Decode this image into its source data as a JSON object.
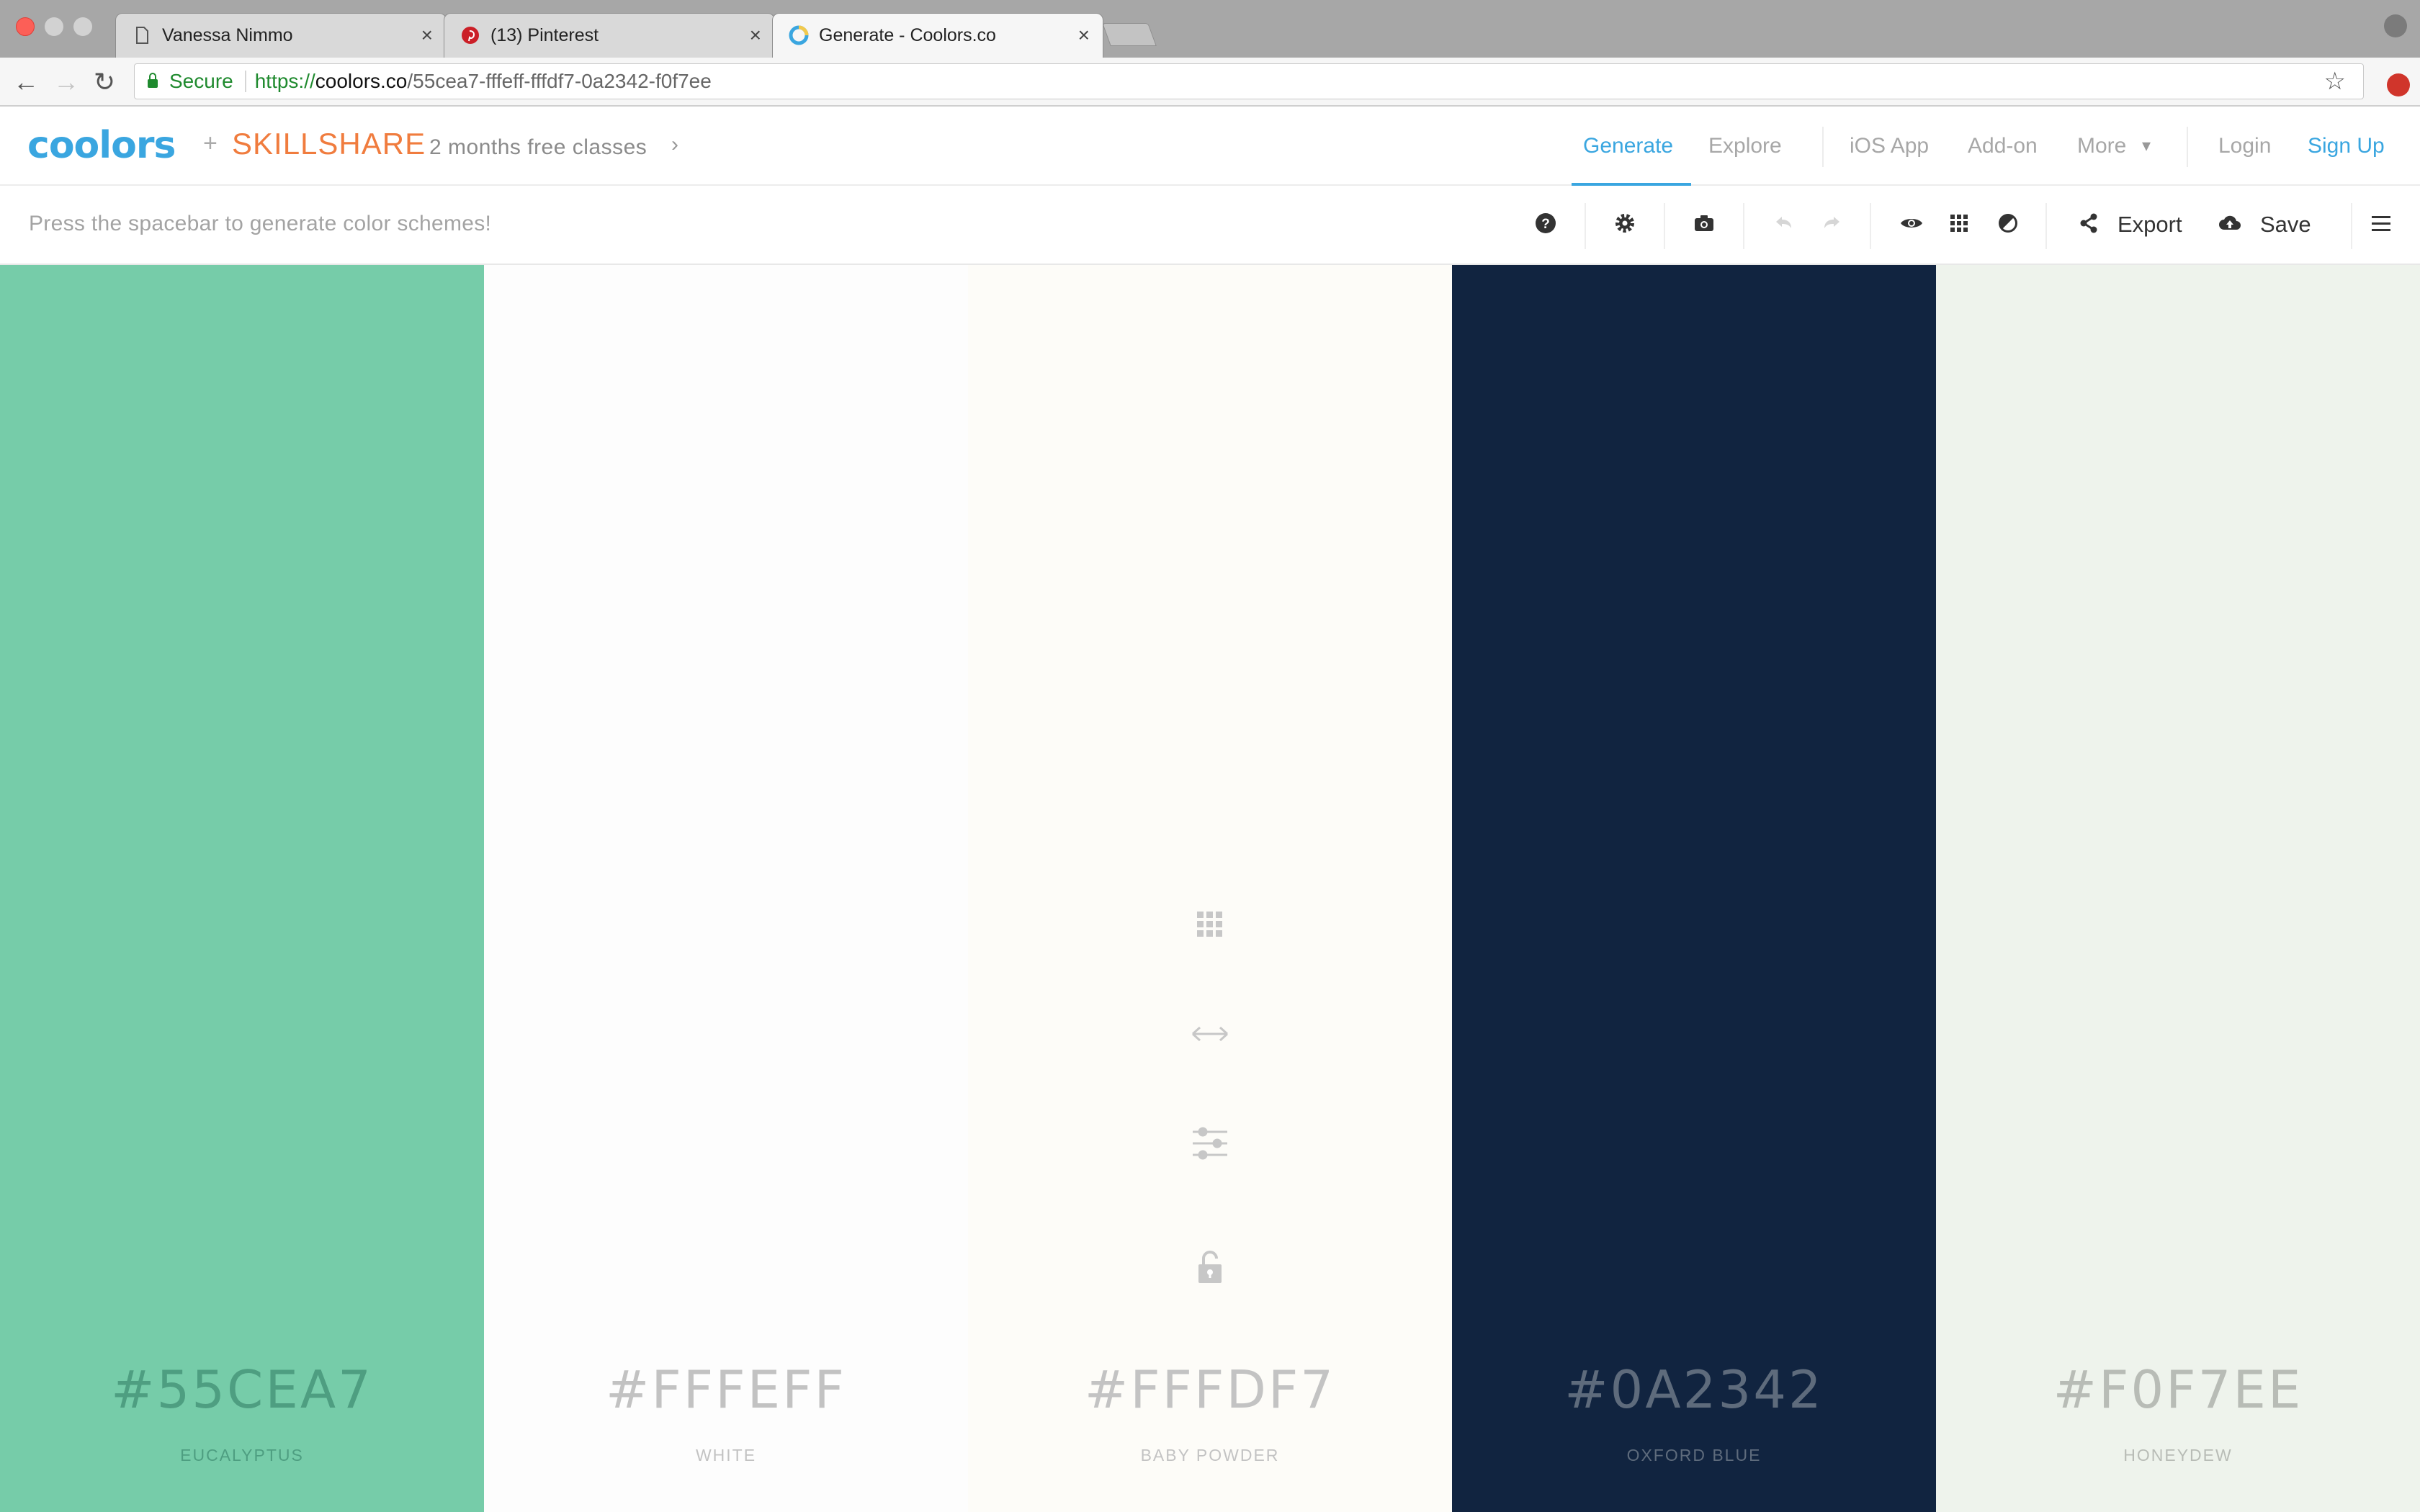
{
  "browser": {
    "tabs": [
      {
        "title": "Vanessa Nimmo",
        "active": false,
        "icon": "document-icon"
      },
      {
        "title": "(13) Pinterest",
        "active": false,
        "icon": "pinterest-icon"
      },
      {
        "title": "Generate - Coolors.co",
        "active": true,
        "icon": "coolors-icon"
      }
    ],
    "security_label": "Secure",
    "url": {
      "scheme": "https://",
      "host": "coolors.co",
      "path": "/55cea7-fffeff-fffdf7-0a2342-f0f7ee"
    }
  },
  "header": {
    "logo": "coolors",
    "partner": "SKILLSHARE",
    "promo": "2 months free classes",
    "nav": {
      "generate": "Generate",
      "explore": "Explore",
      "ios_app": "iOS App",
      "addon": "Add-on",
      "more": "More",
      "login": "Login",
      "signup": "Sign Up"
    }
  },
  "toolbar": {
    "hint": "Press the spacebar to generate color schemes!",
    "export_label": "Export",
    "save_label": "Save",
    "icons": [
      "help-icon",
      "settings-icon",
      "camera-icon",
      "undo-icon",
      "redo-icon",
      "view-icon",
      "grid-icon",
      "adjust-icon",
      "share-icon",
      "upload-icon",
      "menu-icon"
    ]
  },
  "palette": {
    "colors": [
      {
        "hex": "#55CEA7",
        "name": "EUCALYPTUS",
        "bg": "#76cca9",
        "text": "#4e9e81"
      },
      {
        "hex": "#FFFEFF",
        "name": "WHITE",
        "bg": "#fdfdfd",
        "text": "#c2c2c2"
      },
      {
        "hex": "#FFFDF7",
        "name": "BABY POWDER",
        "bg": "#fdfcf8",
        "text": "#c3c3c3"
      },
      {
        "hex": "#0A2342",
        "name": "OXFORD BLUE",
        "bg": "#112440",
        "text": "#5e6b7c"
      },
      {
        "hex": "#F0F7EE",
        "name": "HONEYDEW",
        "bg": "#eef3ec",
        "text": "#b8bcb6"
      }
    ],
    "hovered_swatch_tools": [
      "grid-icon",
      "drag-arrows-icon",
      "sliders-icon",
      "lock-icon"
    ]
  }
}
